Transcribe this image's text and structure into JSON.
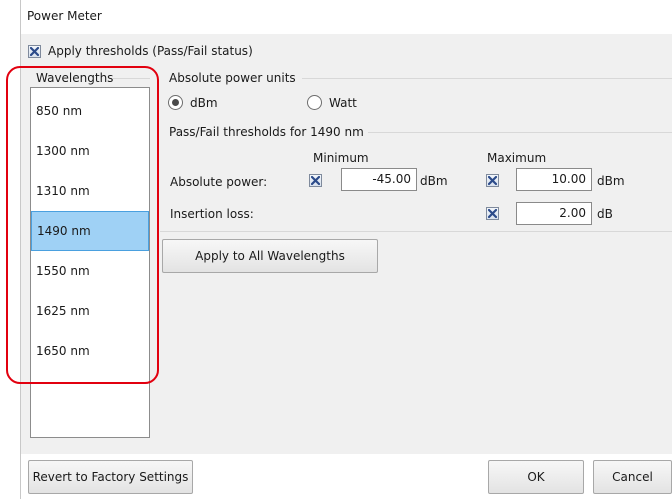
{
  "dialog": {
    "title": "Power Meter"
  },
  "apply_thresholds": {
    "label": "Apply thresholds (Pass/Fail status)",
    "checked": true
  },
  "wavelengths": {
    "legend": "Wavelengths",
    "items": [
      "850 nm",
      "1300 nm",
      "1310 nm",
      "1490 nm",
      "1550 nm",
      "1625 nm",
      "1650 nm"
    ],
    "selected": "1490 nm"
  },
  "units": {
    "legend": "Absolute power units",
    "options": [
      {
        "label": "dBm",
        "selected": true
      },
      {
        "label": "Watt",
        "selected": false
      }
    ]
  },
  "thresholds": {
    "legend": "Pass/Fail thresholds for 1490 nm",
    "min_header": "Minimum",
    "max_header": "Maximum",
    "rows": {
      "absolute_power": {
        "label": "Absolute power:",
        "min_checked": true,
        "min_value": "-45.00",
        "min_unit": "dBm",
        "max_checked": true,
        "max_value": "10.00",
        "max_unit": "dBm"
      },
      "insertion_loss": {
        "label": "Insertion loss:",
        "max_checked": true,
        "max_value": "2.00",
        "max_unit": "dB"
      }
    }
  },
  "buttons": {
    "apply_all": "Apply to All Wavelengths",
    "revert": "Revert to Factory Settings",
    "ok": "OK",
    "cancel": "Cancel"
  },
  "colors": {
    "selection": "#9fd1f5",
    "highlight_outline": "#e2000f"
  }
}
